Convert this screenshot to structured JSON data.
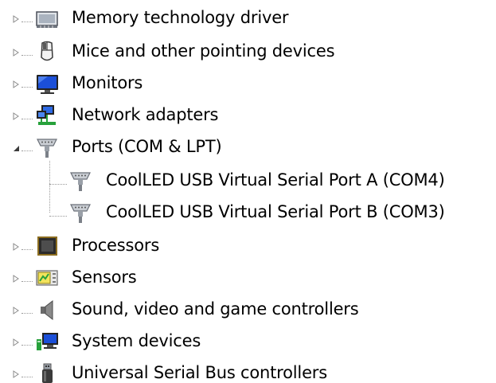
{
  "device_tree": {
    "categories": [
      {
        "label": "Memory technology driver",
        "icon": "memory-card-icon",
        "expanded": false
      },
      {
        "label": "Mice and other pointing devices",
        "icon": "mouse-icon",
        "expanded": false
      },
      {
        "label": "Monitors",
        "icon": "monitor-icon",
        "expanded": false
      },
      {
        "label": "Network adapters",
        "icon": "network-adapter-icon",
        "expanded": false
      },
      {
        "label": "Ports (COM & LPT)",
        "icon": "port-icon",
        "expanded": true,
        "children": [
          {
            "label": "CoolLED USB Virtual Serial Port A (COM4)",
            "icon": "port-icon"
          },
          {
            "label": "CoolLED USB Virtual Serial Port B (COM3)",
            "icon": "port-icon"
          }
        ]
      },
      {
        "label": "Processors",
        "icon": "processor-icon",
        "expanded": false
      },
      {
        "label": "Sensors",
        "icon": "sensor-icon",
        "expanded": false
      },
      {
        "label": "Sound, video and game controllers",
        "icon": "speaker-icon",
        "expanded": false
      },
      {
        "label": "System devices",
        "icon": "system-devices-icon",
        "expanded": false
      },
      {
        "label": "Universal Serial Bus controllers",
        "icon": "usb-plug-icon",
        "expanded": false
      }
    ]
  },
  "colors": {
    "tree_line": "#9a9a9a",
    "collapsed_arrow": "#8a8a8a",
    "expanded_arrow": "#3c3c3c",
    "monitor_blue": "#1b4fd8",
    "network_green": "#27a13b"
  }
}
